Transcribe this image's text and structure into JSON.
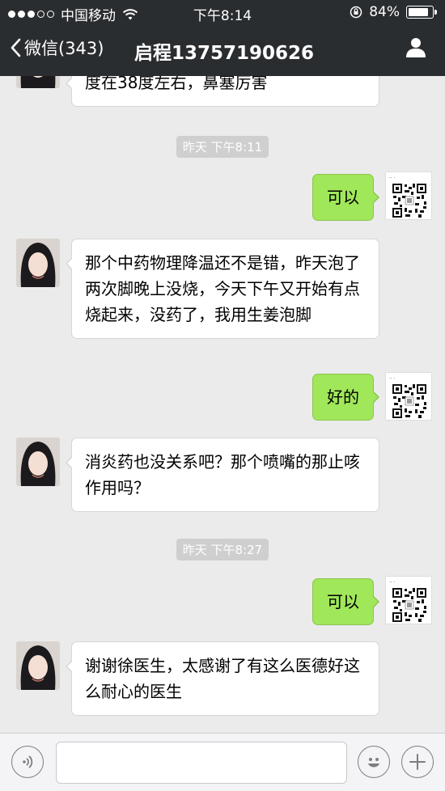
{
  "status_bar": {
    "carrier": "中国移动",
    "time": "下午8:14",
    "battery": "84%",
    "battery_level": 0.84
  },
  "nav": {
    "back_label": "微信(343)",
    "title": "启程13757190626"
  },
  "messages": [
    {
      "type": "incoming",
      "text": "度在38度左右，鼻塞厉害"
    },
    {
      "type": "time",
      "text": "昨天  下午8:11"
    },
    {
      "type": "outgoing",
      "text": "可以"
    },
    {
      "type": "incoming",
      "text": "那个中药物理降温还不是错，昨天泡了两次脚晚上没烧，今天下午又开始有点烧起来，没药了，我用生姜泡脚"
    },
    {
      "type": "outgoing",
      "text": "好的"
    },
    {
      "type": "incoming",
      "text": "消炎药也没关系吧？那个喷嘴的那止咳作用吗？"
    },
    {
      "type": "time",
      "text": "昨天  下午8:27"
    },
    {
      "type": "outgoing",
      "text": "可以"
    },
    {
      "type": "incoming",
      "text": "谢谢徐医生，太感谢了有这么医德好这么耐心的医生"
    }
  ],
  "icons": {
    "back": "chevron-left-icon",
    "profile": "person-icon",
    "voice": "voice-icon",
    "emoji": "emoji-icon",
    "plus": "plus-icon"
  },
  "colors": {
    "nav_bg": "#2a2d30",
    "chat_bg": "#ebebeb",
    "outgoing_bubble": "#a0e75a",
    "incoming_bubble": "#ffffff"
  }
}
